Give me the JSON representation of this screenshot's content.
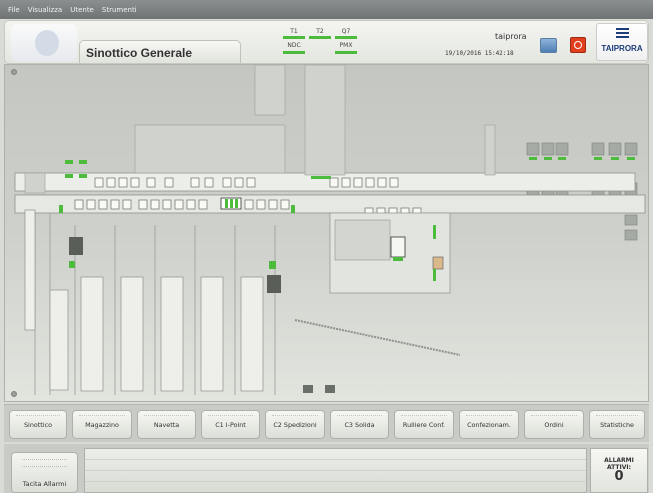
{
  "menu": [
    "File",
    "Visualizza",
    "Utente",
    "Strumenti"
  ],
  "header": {
    "title": "Sinottico Generale",
    "indicators": [
      {
        "top": "T1",
        "bottom": "NDC"
      },
      {
        "top": "T2",
        "bottom": ""
      },
      {
        "top": "Q7",
        "bottom": "PMX"
      }
    ],
    "user": "taiprora",
    "datetime": "19/10/2016 15:42:18",
    "brand": "TAIPRORA"
  },
  "nav_buttons": [
    "Sinottico",
    "Magazzino",
    "Navetta",
    "C1 I-Point",
    "C2 Spedizioni",
    "C3 Solida",
    "Rulliere Conf.",
    "Confezionam.",
    "Ordini",
    "Statistiche"
  ],
  "alarms": {
    "silence_label": "Tacita Allarmi",
    "active_label_1": "ALLARMI",
    "active_label_2": "ATTIVI:",
    "active_count": "0"
  },
  "colors": {
    "accent_green": "#4dbb3c",
    "power_red": "#e1401f"
  }
}
